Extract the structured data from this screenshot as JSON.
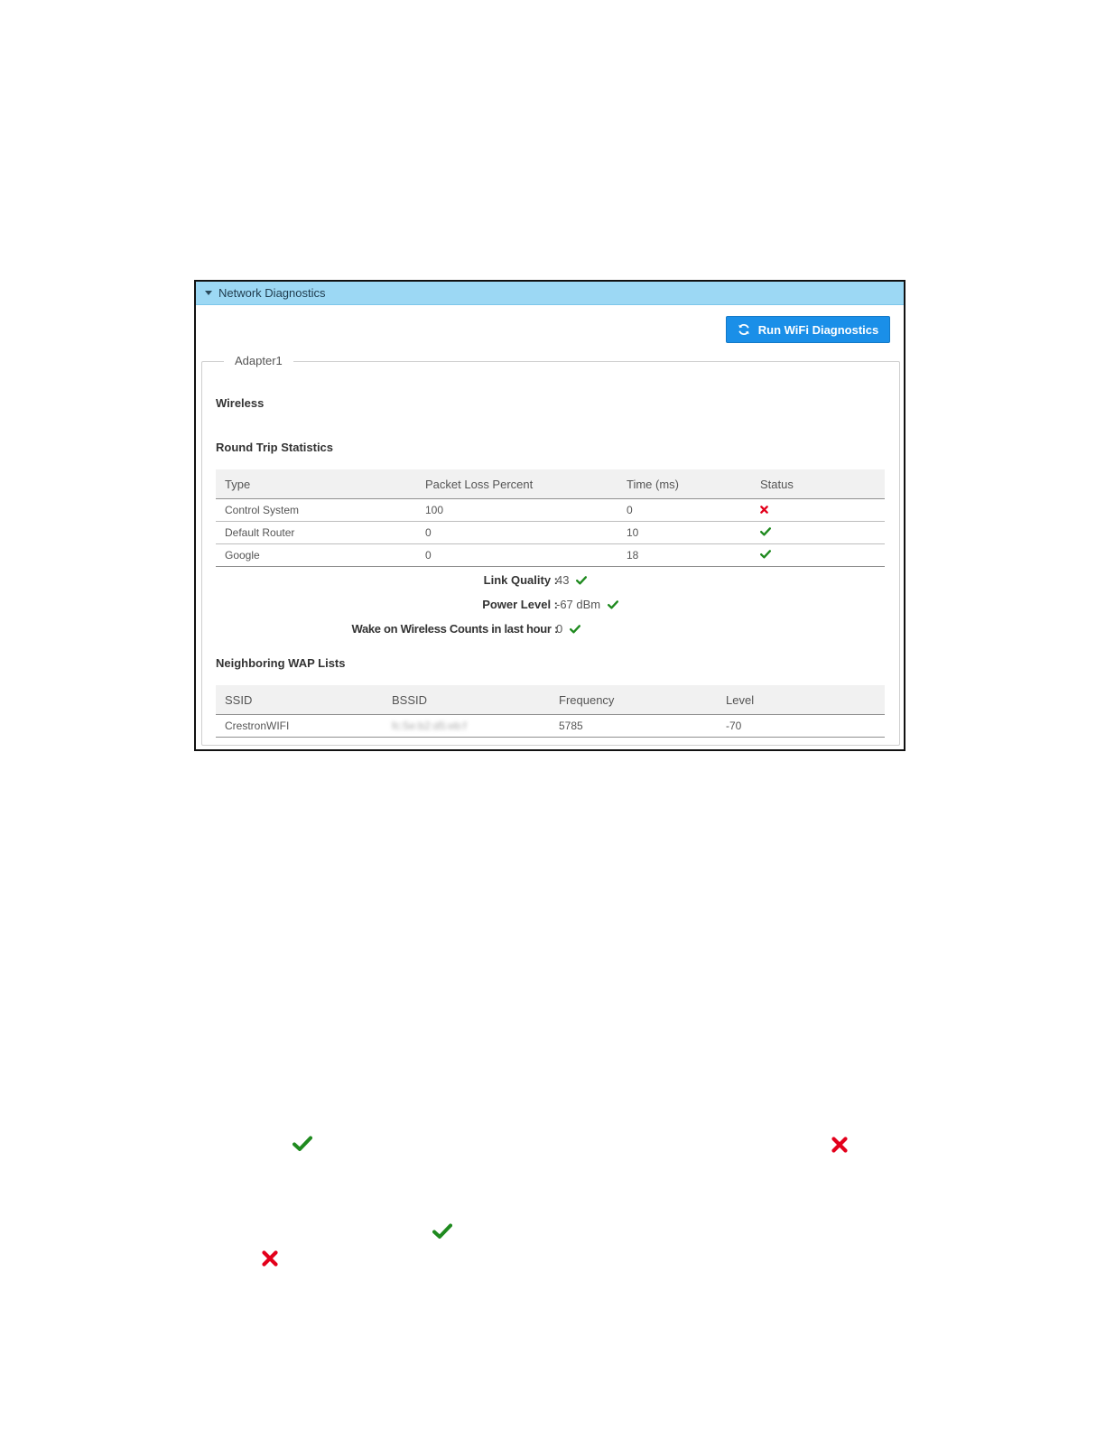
{
  "panel": {
    "title": "Network Diagnostics"
  },
  "toolbar": {
    "run_label": "Run WiFi Diagnostics"
  },
  "adapter": {
    "legend": "Adapter1",
    "wireless_title": "Wireless",
    "round_trip": {
      "title": "Round Trip Statistics",
      "headers": [
        "Type",
        "Packet Loss Percent",
        "Time (ms)",
        "Status"
      ],
      "rows": [
        {
          "type": "Control System",
          "loss": "100",
          "time": "0",
          "status": "fail"
        },
        {
          "type": "Default Router",
          "loss": "0",
          "time": "10",
          "status": "ok"
        },
        {
          "type": "Google",
          "loss": "0",
          "time": "18",
          "status": "ok"
        }
      ]
    },
    "link_quality": {
      "label": "Link Quality :",
      "value": "43",
      "status": "ok"
    },
    "power_level": {
      "label": "Power Level :",
      "value": "-67 dBm",
      "status": "ok"
    },
    "wake_counts": {
      "label": "Wake on Wireless Counts in last hour :",
      "value": "0",
      "status": "ok"
    },
    "wap": {
      "title": "Neighboring WAP Lists",
      "headers": [
        "SSID",
        "BSSID",
        "Frequency",
        "Level"
      ],
      "rows": [
        {
          "ssid": "CrestronWIFI",
          "bssid": "fc:5e:b2:d5:eb:f",
          "frequency": "5785",
          "level": "-70"
        }
      ]
    }
  },
  "colors": {
    "ok": "#1f8a1f",
    "fail": "#e3001b",
    "header_bg": "#9cd8f4",
    "button_bg": "#1a8fe8"
  }
}
